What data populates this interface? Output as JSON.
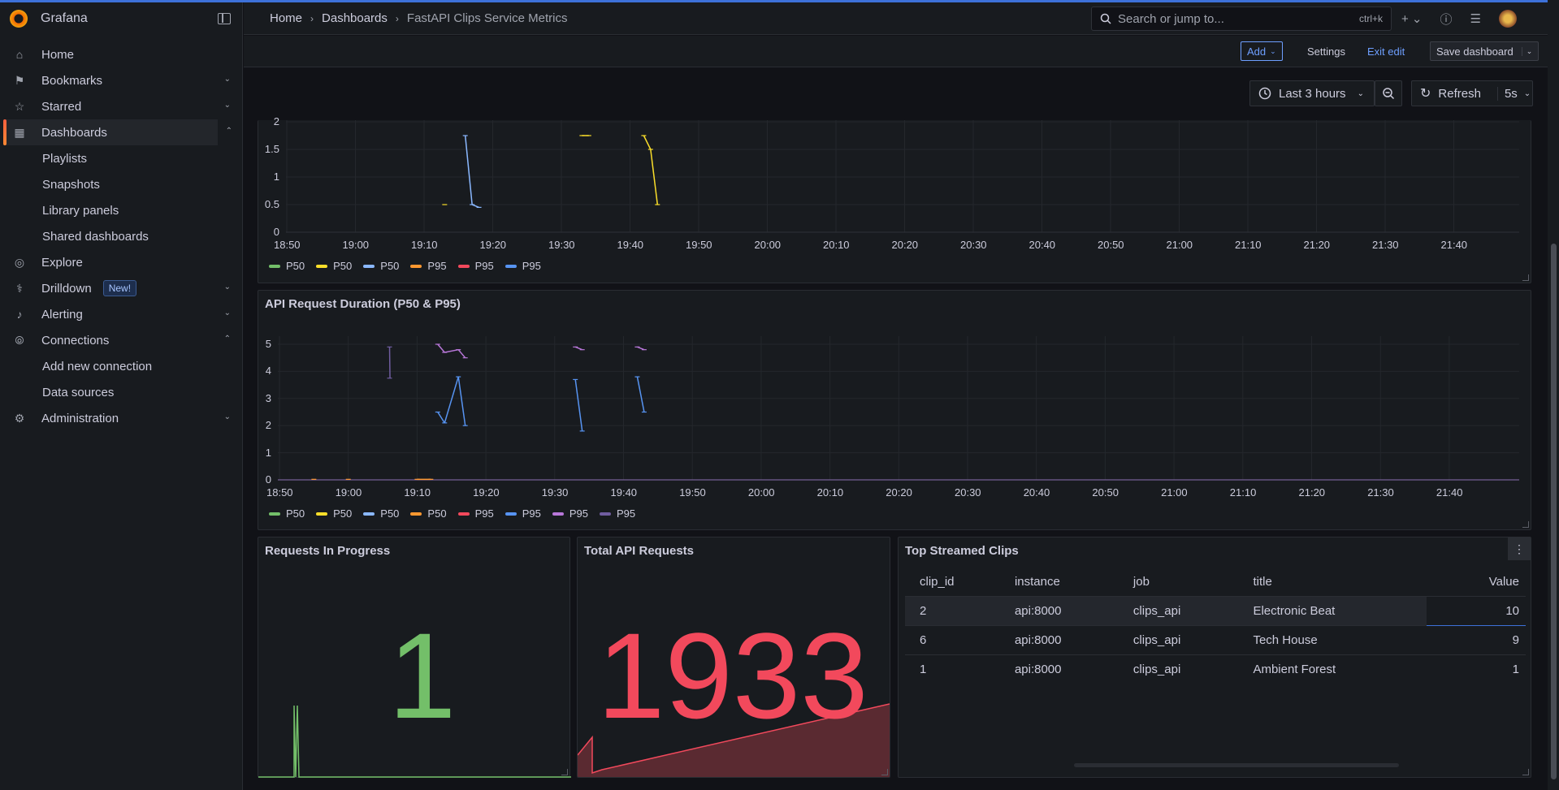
{
  "app": {
    "name": "Grafana"
  },
  "sidebar": {
    "items": [
      {
        "label": "Home",
        "icon": "home-icon"
      },
      {
        "label": "Bookmarks",
        "icon": "bookmark-icon",
        "chevron": "down"
      },
      {
        "label": "Starred",
        "icon": "star-icon",
        "chevron": "down"
      },
      {
        "label": "Dashboards",
        "icon": "apps-icon",
        "chevron": "up",
        "active": true
      },
      {
        "label": "Playlists",
        "sub": true
      },
      {
        "label": "Snapshots",
        "sub": true
      },
      {
        "label": "Library panels",
        "sub": true
      },
      {
        "label": "Shared dashboards",
        "sub": true
      },
      {
        "label": "Explore",
        "icon": "compass-icon"
      },
      {
        "label": "Drilldown",
        "icon": "drilldown-icon",
        "chevron": "down",
        "badge": "New!"
      },
      {
        "label": "Alerting",
        "icon": "bell-icon",
        "chevron": "down"
      },
      {
        "label": "Connections",
        "icon": "connections-icon",
        "chevron": "up"
      },
      {
        "label": "Add new connection",
        "sub": true
      },
      {
        "label": "Data sources",
        "sub": true
      },
      {
        "label": "Administration",
        "icon": "cog-icon",
        "chevron": "down"
      }
    ]
  },
  "header": {
    "breadcrumbs": [
      "Home",
      "Dashboards",
      "FastAPI Clips Service Metrics"
    ],
    "search_placeholder": "Search or jump to...",
    "search_shortcut": "ctrl+k"
  },
  "toolbar": {
    "add_label": "Add",
    "settings_label": "Settings",
    "exit_edit_label": "Exit edit",
    "save_label": "Save dashboard"
  },
  "time": {
    "range_label": "Last 3 hours",
    "refresh_label": "Refresh",
    "interval_label": "5s"
  },
  "panels": {
    "top_chart": {
      "y_ticks": [
        "2",
        "1.5",
        "1",
        "0.5",
        "0"
      ],
      "x_ticks": [
        "18:50",
        "19:00",
        "19:10",
        "19:20",
        "19:30",
        "19:40",
        "19:50",
        "20:00",
        "20:10",
        "20:20",
        "20:30",
        "20:40",
        "20:50",
        "21:00",
        "21:10",
        "21:20",
        "21:30",
        "21:40"
      ],
      "legend": [
        {
          "name": "P50",
          "color": "#73bf69"
        },
        {
          "name": "P50",
          "color": "#fade2a"
        },
        {
          "name": "P50",
          "color": "#8ab8ff"
        },
        {
          "name": "P95",
          "color": "#ff9830"
        },
        {
          "name": "P95",
          "color": "#f2495c"
        },
        {
          "name": "P95",
          "color": "#5794f2"
        }
      ]
    },
    "duration_chart": {
      "title": "API Request Duration (P50 & P95)",
      "y_ticks": [
        "5",
        "4",
        "3",
        "2",
        "1",
        "0"
      ],
      "x_ticks": [
        "18:50",
        "19:00",
        "19:10",
        "19:20",
        "19:30",
        "19:40",
        "19:50",
        "20:00",
        "20:10",
        "20:20",
        "20:30",
        "20:40",
        "20:50",
        "21:00",
        "21:10",
        "21:20",
        "21:30",
        "21:40"
      ],
      "legend": [
        {
          "name": "P50",
          "color": "#73bf69"
        },
        {
          "name": "P50",
          "color": "#fade2a"
        },
        {
          "name": "P50",
          "color": "#8ab8ff"
        },
        {
          "name": "P50",
          "color": "#ff9830"
        },
        {
          "name": "P95",
          "color": "#f2495c"
        },
        {
          "name": "P95",
          "color": "#5794f2"
        },
        {
          "name": "P95",
          "color": "#b877d9"
        },
        {
          "name": "P95",
          "color": "#705da0"
        }
      ]
    },
    "in_progress": {
      "title": "Requests In Progress",
      "value": "1",
      "color": "#73bf69"
    },
    "total_requests": {
      "title": "Total API Requests",
      "value": "1933",
      "color": "#f2495c"
    },
    "top_clips": {
      "title": "Top Streamed Clips",
      "columns": [
        "clip_id",
        "instance",
        "job",
        "title",
        "Value"
      ],
      "rows": [
        {
          "clip_id": "2",
          "instance": "api:8000",
          "job": "clips_api",
          "title": "Electronic Beat",
          "value": "10"
        },
        {
          "clip_id": "6",
          "instance": "api:8000",
          "job": "clips_api",
          "title": "Tech House",
          "value": "9"
        },
        {
          "clip_id": "1",
          "instance": "api:8000",
          "job": "clips_api",
          "title": "Ambient Forest",
          "value": "1"
        }
      ]
    }
  },
  "chart_data": [
    {
      "type": "line",
      "title": "",
      "x": [
        "18:50",
        "19:00",
        "19:10",
        "19:20",
        "19:30",
        "19:40",
        "19:50",
        "20:00",
        "20:10",
        "20:20",
        "20:30",
        "20:40",
        "20:50",
        "21:00",
        "21:10",
        "21:20",
        "21:30",
        "21:40"
      ],
      "ylim": [
        0,
        2
      ],
      "series": [
        {
          "name": "P50",
          "color": "#8ab8ff",
          "points": [
            [
              "19:16",
              1.75
            ],
            [
              "19:17",
              0.5
            ],
            [
              "19:18",
              0.45
            ]
          ]
        },
        {
          "name": "P50",
          "color": "#fade2a",
          "points": [
            [
              "19:13",
              0.5
            ],
            [
              "19:33",
              1.75
            ],
            [
              "19:34",
              1.75
            ],
            [
              "19:42",
              1.75
            ],
            [
              "19:43",
              1.5
            ],
            [
              "19:44",
              0.5
            ]
          ]
        }
      ]
    },
    {
      "type": "line",
      "title": "API Request Duration (P50 & P95)",
      "x": [
        "18:50",
        "19:00",
        "19:10",
        "19:20",
        "19:30",
        "19:40",
        "19:50",
        "20:00",
        "20:10",
        "20:20",
        "20:30",
        "20:40",
        "20:50",
        "21:00",
        "21:10",
        "21:20",
        "21:30",
        "21:40"
      ],
      "ylim": [
        0,
        5
      ],
      "series": [
        {
          "name": "P95",
          "color": "#705da0",
          "points": [
            [
              "19:06",
              4.9
            ],
            [
              "19:06",
              3.75
            ]
          ]
        },
        {
          "name": "P95",
          "color": "#b877d9",
          "points": [
            [
              "19:13",
              5.0
            ],
            [
              "19:14",
              4.7
            ],
            [
              "19:16",
              4.8
            ],
            [
              "19:17",
              4.5
            ],
            [
              "19:33",
              4.9
            ],
            [
              "19:34",
              4.8
            ],
            [
              "19:42",
              4.9
            ],
            [
              "19:43",
              4.8
            ]
          ]
        },
        {
          "name": "P95",
          "color": "#5794f2",
          "points": [
            [
              "19:13",
              2.5
            ],
            [
              "19:14",
              2.1
            ],
            [
              "19:16",
              3.8
            ],
            [
              "19:17",
              2.0
            ],
            [
              "19:33",
              3.7
            ],
            [
              "19:34",
              1.8
            ],
            [
              "19:42",
              3.8
            ],
            [
              "19:43",
              2.5
            ]
          ]
        },
        {
          "name": "P50",
          "color": "#ff9830",
          "points": [
            [
              "18:55",
              0.02
            ],
            [
              "19:00",
              0.02
            ],
            [
              "19:10",
              0.02
            ],
            [
              "19:12",
              0.02
            ]
          ]
        }
      ]
    }
  ]
}
